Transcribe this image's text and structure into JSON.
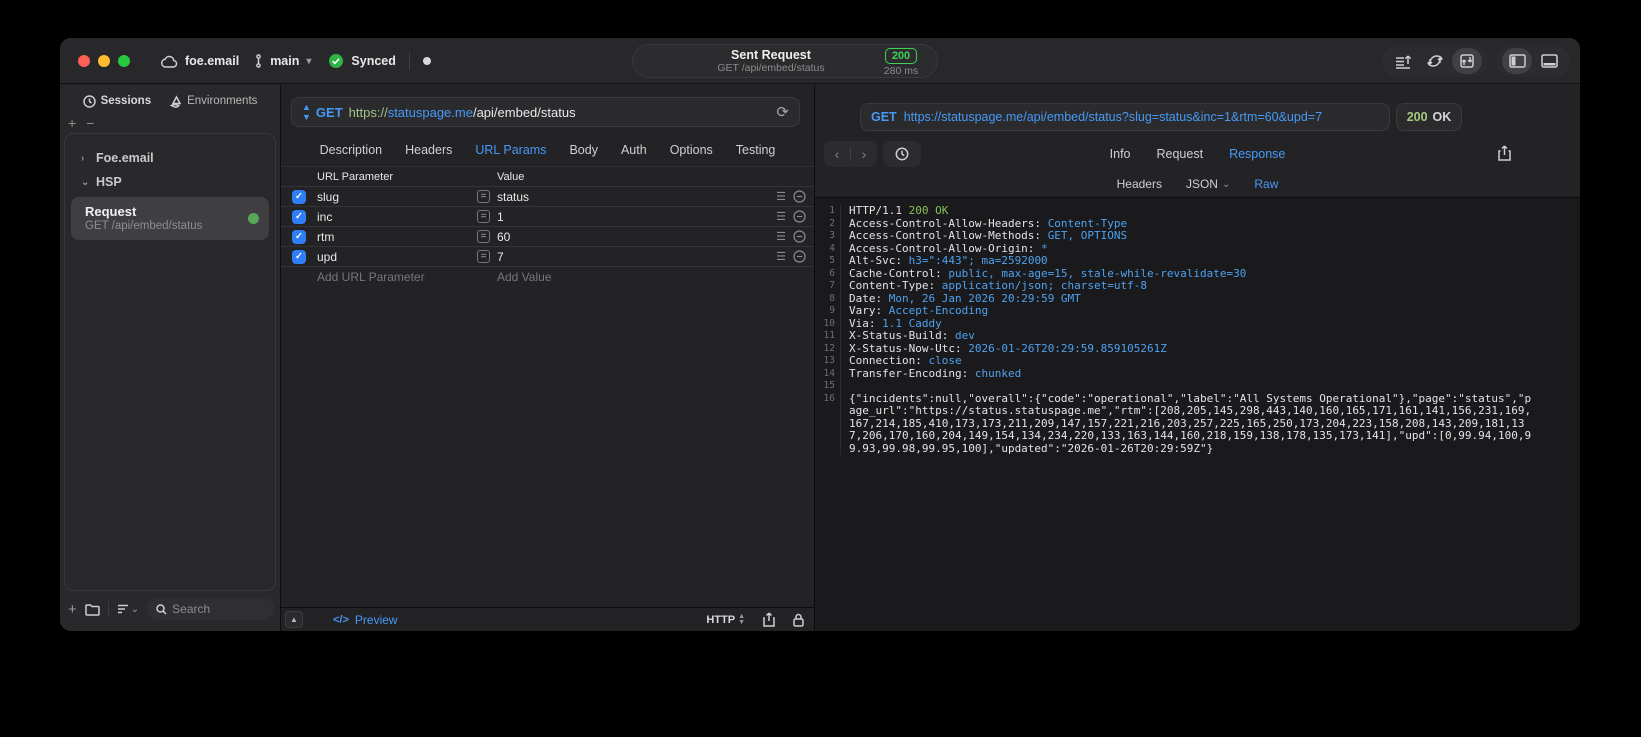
{
  "titlebar": {
    "workspace": "foe.email",
    "branch": "main",
    "sync_status": "Synced",
    "request_title": "Sent Request",
    "request_subtitle": "GET /api/embed/status",
    "status_code": "200",
    "duration": "280 ms"
  },
  "colors": {
    "accent_blue": "#4699f7",
    "status_green": "#3fd158",
    "traffic_red": "#ff5f57",
    "traffic_yellow": "#febc2e",
    "traffic_green": "#28c840"
  },
  "sidebar": {
    "tabs": [
      {
        "label": "Sessions",
        "icon": "clock-icon",
        "active": true
      },
      {
        "label": "Environments",
        "icon": "layers-icon",
        "active": false
      }
    ],
    "tree": [
      {
        "label": "Foe.email",
        "collapsed": true
      },
      {
        "label": "HSP",
        "collapsed": false
      }
    ],
    "request_item": {
      "title": "Request",
      "subtitle": "GET /api/embed/status",
      "selected": true
    },
    "search_placeholder": "Search"
  },
  "request_panel": {
    "method": "GET",
    "url_scheme": "https://",
    "url_host": "statuspage.me",
    "url_path": "/api/embed/status",
    "tabs": [
      "Description",
      "Headers",
      "URL Params",
      "Body",
      "Auth",
      "Options",
      "Testing"
    ],
    "active_tab": "URL Params",
    "table": {
      "columns": [
        "URL Parameter",
        "Value"
      ],
      "rows": [
        {
          "name": "slug",
          "value": "status",
          "checked": true
        },
        {
          "name": "inc",
          "value": "1",
          "checked": true
        },
        {
          "name": "rtm",
          "value": "60",
          "checked": true
        },
        {
          "name": "upd",
          "value": "7",
          "checked": true
        }
      ],
      "add_name_placeholder": "Add URL Parameter",
      "add_value_placeholder": "Add Value"
    },
    "footer": {
      "preview_label": "Preview",
      "protocol": "HTTP"
    }
  },
  "response_panel": {
    "method": "GET",
    "url": "https://statuspage.me/api/embed/status?slug=status&inc=1&rtm=60&upd=7",
    "status_code": "200",
    "status_text": "OK",
    "tabs": [
      "Info",
      "Request",
      "Response"
    ],
    "active_tab": "Response",
    "subtabs": [
      "Headers",
      "JSON",
      "Raw"
    ],
    "active_subtab": "Raw",
    "code_lines": [
      {
        "n": "1",
        "parts": [
          [
            "HTTP/1.1 ",
            "p"
          ],
          [
            "200 OK",
            "g"
          ]
        ]
      },
      {
        "n": "2",
        "parts": [
          [
            "Access-Control-Allow-Headers: ",
            "p"
          ],
          [
            "Content-Type",
            "b"
          ]
        ]
      },
      {
        "n": "3",
        "parts": [
          [
            "Access-Control-Allow-Methods: ",
            "p"
          ],
          [
            "GET, OPTIONS",
            "b"
          ]
        ]
      },
      {
        "n": "4",
        "parts": [
          [
            "Access-Control-Allow-Origin: ",
            "p"
          ],
          [
            "*",
            "b"
          ]
        ]
      },
      {
        "n": "5",
        "parts": [
          [
            "Alt-Svc: ",
            "p"
          ],
          [
            "h3=\":443\"; ma=2592000",
            "b"
          ]
        ]
      },
      {
        "n": "6",
        "parts": [
          [
            "Cache-Control: ",
            "p"
          ],
          [
            "public, max-age=15, stale-while-revalidate=30",
            "b"
          ]
        ]
      },
      {
        "n": "7",
        "parts": [
          [
            "Content-Type: ",
            "p"
          ],
          [
            "application/json; charset=utf-8",
            "b"
          ]
        ]
      },
      {
        "n": "8",
        "parts": [
          [
            "Date: ",
            "p"
          ],
          [
            "Mon, 26 Jan 2026 20:29:59 GMT",
            "b"
          ]
        ]
      },
      {
        "n": "9",
        "parts": [
          [
            "Vary: ",
            "p"
          ],
          [
            "Accept-Encoding",
            "b"
          ]
        ]
      },
      {
        "n": "10",
        "parts": [
          [
            "Via: ",
            "p"
          ],
          [
            "1.1 Caddy",
            "b"
          ]
        ]
      },
      {
        "n": "11",
        "parts": [
          [
            "X-Status-Build: ",
            "p"
          ],
          [
            "dev",
            "b"
          ]
        ]
      },
      {
        "n": "12",
        "parts": [
          [
            "X-Status-Now-Utc: ",
            "p"
          ],
          [
            "2026-01-26T20:29:59.859105261Z",
            "b"
          ]
        ]
      },
      {
        "n": "13",
        "parts": [
          [
            "Connection: ",
            "p"
          ],
          [
            "close",
            "b"
          ]
        ]
      },
      {
        "n": "14",
        "parts": [
          [
            "Transfer-Encoding: ",
            "p"
          ],
          [
            "chunked",
            "b"
          ]
        ]
      },
      {
        "n": "15",
        "parts": []
      },
      {
        "n": "16",
        "parts": [
          [
            "{\"incidents\":null,\"overall\":{\"code\":\"operational\",\"label\":\"All Systems Operational\"},\"page\":\"status\",\"page_url\":\"https://status.statuspage.me\",\"rtm\":[208,205,145,298,443,140,160,165,171,161,141,156,231,169,167,214,185,410,173,173,211,209,147,157,221,216,203,257,225,165,250,173,204,223,158,208,143,209,181,137,206,170,160,204,149,154,134,234,220,133,163,144,160,218,159,138,178,135,173,141],\"upd\":[0,99.94,100,99.93,99.98,99.95,100],\"updated\":\"2026-01-26T20:29:59Z\"}",
            "p"
          ]
        ]
      }
    ]
  }
}
